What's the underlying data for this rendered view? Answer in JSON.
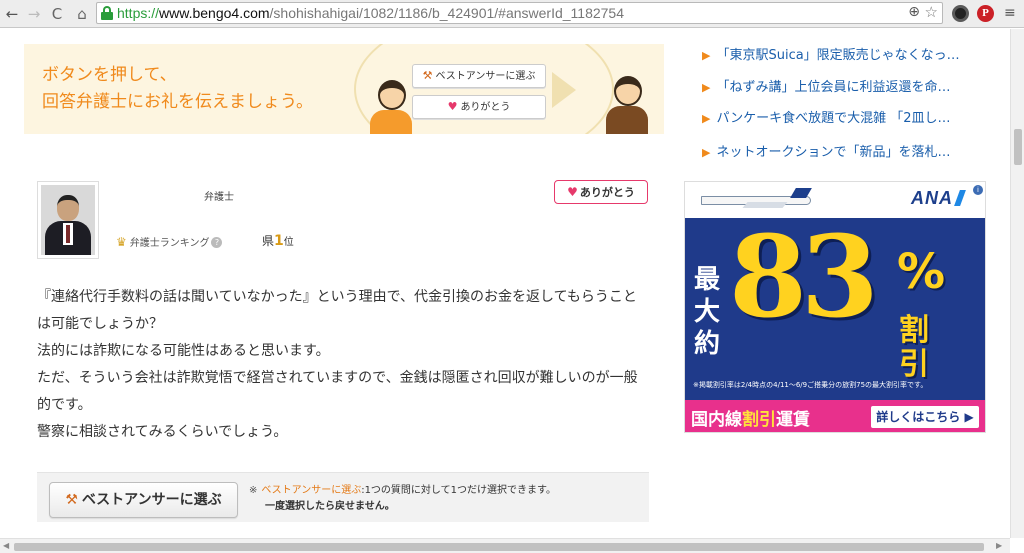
{
  "browser": {
    "url_scheme": "https://",
    "url_host": "www.bengo4.com",
    "url_path": "/shohishahigai/1082/1186/b_424901/#answerId_1182754",
    "back_glyph": "←",
    "forward_glyph": "→",
    "reload_glyph": "C",
    "home_glyph": "⌂",
    "zoom_glyph": "⊕",
    "star_glyph": "☆",
    "pinterest_glyph": "P",
    "menu_glyph": "≡"
  },
  "promo": {
    "line1": "ボタンを押して、",
    "line2": "回答弁護士にお礼を伝えましょう。",
    "best_answer_label": "ベストアンサーに選ぶ",
    "thanks_label": "ありがとう",
    "text_color": "#f08a1c",
    "background": "#fdf5e0"
  },
  "answer": {
    "lawyer_title": "弁護士",
    "thanks_button": "ありがとう",
    "ranking_label": "弁護士ランキング",
    "rank_prefix": "県",
    "rank_number": "1",
    "rank_suffix": "位",
    "paragraphs": [
      "『連絡代行手数料の話は聞いていなかった』という理由で、代金引換のお金を返してもらうことは可能でしょうか？",
      "",
      "法的には詐欺になる可能性はあると思います。",
      "ただ、そういう会社は詐欺覚悟で経営されていますので、金銭は隠匿され回収が難しいのが一般的です。",
      "警察に相談されてみるくらいでしょう。"
    ]
  },
  "best_answer": {
    "button_label": "ベストアンサーに選ぶ",
    "note_mark": "※",
    "note_link": "ベストアンサーに選ぶ",
    "note_text": ":1つの質問に対して1つだけ選択できます。",
    "note_line2": "一度選択したら戻せません。",
    "link_color": "#e47a17"
  },
  "news": [
    "「東京駅Suica」限定販売じゃなくなっ…",
    "「ねずみ講」上位会員に利益返還を命…",
    "パンケーキ食べ放題で大混雑 「2皿し…",
    "ネットオークションで「新品」を落札…"
  ],
  "ad": {
    "logo": "ANA",
    "vertical_text": "最大約",
    "big_number": "83",
    "percent": "%",
    "discount_line1": "割",
    "discount_line2": "引",
    "fine_print": "※掲載割引率は2/4時点の4/11〜6/9ご搭乗分の旅割75の最大割引率です。",
    "bottom_pre": "国内線",
    "bottom_highlight": "割引",
    "bottom_post": "運賃",
    "cta": "詳しくはこちら ▶",
    "brand_blue": "#1f3a8a",
    "accent_pink": "#e8308c",
    "accent_yellow": "#ffd21f"
  }
}
